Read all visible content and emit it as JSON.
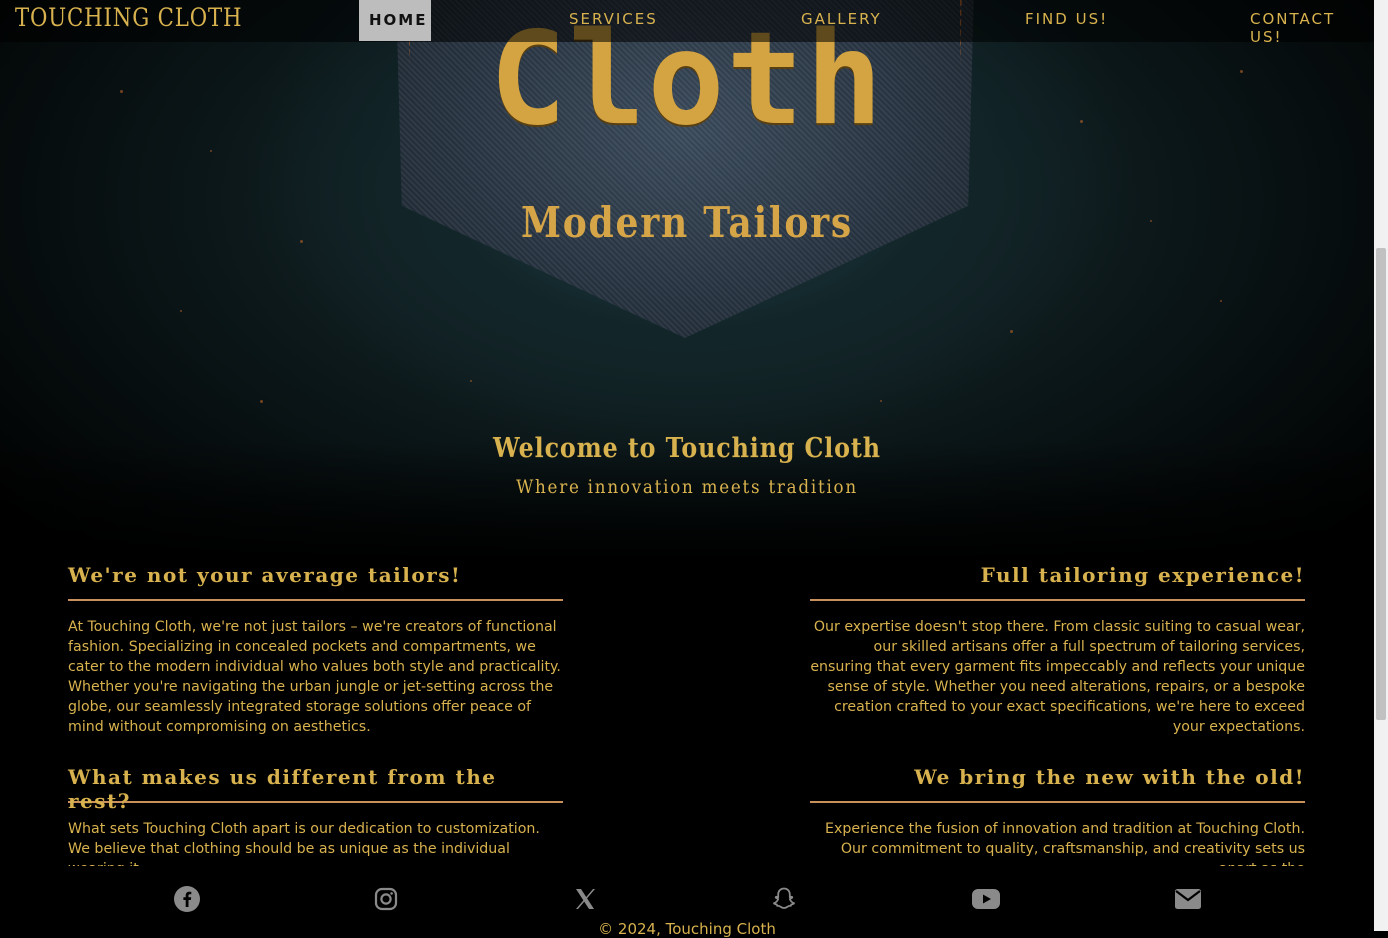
{
  "nav": {
    "brand": "TOUCHING CLOTH",
    "items": [
      {
        "label": "HOME",
        "active": true
      },
      {
        "label": "SERVICES"
      },
      {
        "label": "GALLERY"
      },
      {
        "label": "FIND US!"
      },
      {
        "label": "CONTACT US!"
      }
    ]
  },
  "hero": {
    "title": "Cloth",
    "subtitle": "Modern Tailors",
    "welcome": "Welcome to Touching Cloth",
    "tagline": "Where innovation meets tradition"
  },
  "sections": [
    {
      "heading": "We're not your average tailors!",
      "body": "At Touching Cloth, we're not just tailors – we're creators of functional fashion. Specializing in concealed pockets and compartments, we cater to the modern individual who values both style and practicality. Whether you're navigating the urban jungle or jet-setting across the globe, our seamlessly integrated storage solutions offer peace of mind without compromising on aesthetics."
    },
    {
      "heading": "Full tailoring experience!",
      "body": "Our expertise doesn't stop there. From classic suiting to casual wear, our skilled artisans offer a full spectrum of tailoring services, ensuring that every garment fits impeccably and reflects your unique sense of style. Whether you need alterations, repairs, or a bespoke creation crafted to your exact specifications, we're here to exceed your expectations."
    },
    {
      "heading": "What makes us different from the rest?",
      "body": "What sets Touching Cloth apart is our dedication to customization. We believe that clothing should be as unique as the individual wearing it."
    },
    {
      "heading": "We bring the new with the old!",
      "body": "Experience the fusion of innovation and tradition at Touching Cloth. Our commitment to quality, craftsmanship, and creativity sets us apart as the"
    }
  ],
  "social": [
    "facebook-icon",
    "instagram-icon",
    "x-icon",
    "snapchat-icon",
    "youtube-icon",
    "envelope-icon"
  ],
  "footer": {
    "copyright": "© 2024, Touching Cloth"
  },
  "colors": {
    "accent": "#d8b24e",
    "rule": "#c8915c",
    "background": "#000000"
  }
}
